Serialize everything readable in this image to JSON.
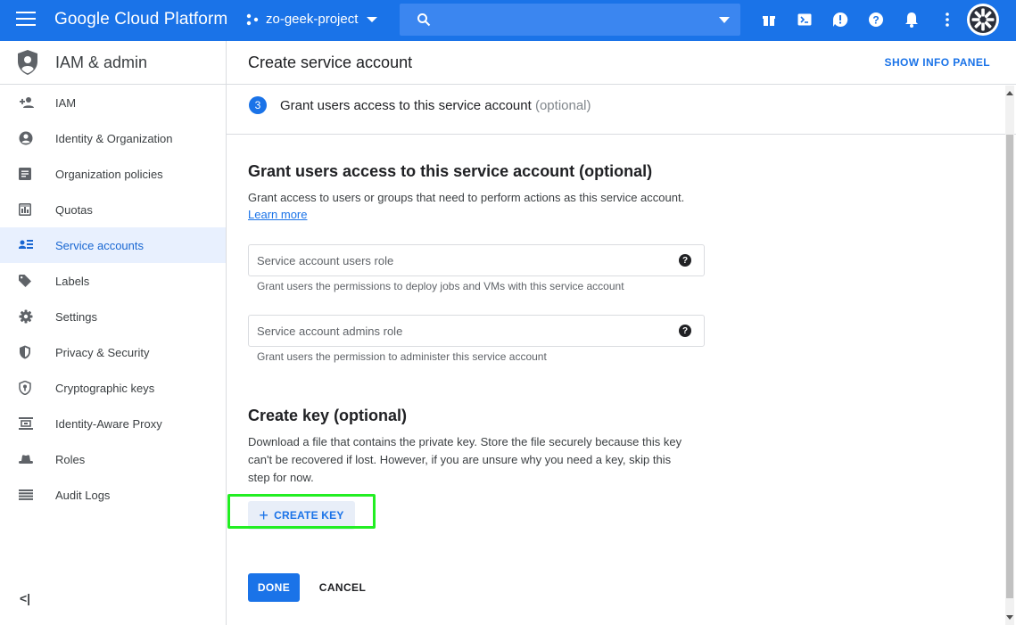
{
  "topbar": {
    "brand": "Google Cloud Platform",
    "project": "zo-geek-project",
    "search_placeholder": ""
  },
  "sidebar": {
    "title": "IAM & admin",
    "items": [
      {
        "label": "IAM",
        "icon": "person-add-icon"
      },
      {
        "label": "Identity & Organization",
        "icon": "account-circle-icon"
      },
      {
        "label": "Organization policies",
        "icon": "policy-document-icon"
      },
      {
        "label": "Quotas",
        "icon": "quota-icon"
      },
      {
        "label": "Service accounts",
        "icon": "service-account-icon",
        "active": true
      },
      {
        "label": "Labels",
        "icon": "label-tag-icon"
      },
      {
        "label": "Settings",
        "icon": "gear-icon"
      },
      {
        "label": "Privacy & Security",
        "icon": "shield-icon"
      },
      {
        "label": "Cryptographic keys",
        "icon": "key-shield-icon"
      },
      {
        "label": "Identity-Aware Proxy",
        "icon": "proxy-icon"
      },
      {
        "label": "Roles",
        "icon": "hat-icon"
      },
      {
        "label": "Audit Logs",
        "icon": "list-icon"
      }
    ],
    "collapse_label": "<|"
  },
  "main": {
    "page_title": "Create service account",
    "show_info_panel": "SHOW INFO PANEL",
    "step": {
      "number": "3",
      "label": "Grant users access to this service account",
      "optional": "(optional)"
    },
    "grant": {
      "heading": "Grant users access to this service account (optional)",
      "description": "Grant access to users or groups that need to perform actions as this service account.",
      "learn_more": "Learn more",
      "users_role_placeholder": "Service account users role",
      "users_role_hint": "Grant users the permissions to deploy jobs and VMs with this service account",
      "admins_role_placeholder": "Service account admins role",
      "admins_role_hint": "Grant users the permission to administer this service account",
      "help_glyph": "?"
    },
    "key": {
      "heading": "Create key (optional)",
      "description": "Download a file that contains the private key. Store the file securely because this key can't be recovered if lost. However, if you are unsure why you need a key, skip this step for now.",
      "create_key_label": "CREATE KEY",
      "plus_glyph": "+"
    },
    "actions": {
      "done_label": "DONE",
      "cancel_label": "CANCEL"
    }
  },
  "colors": {
    "brand_blue": "#1a73e8",
    "highlight": "#22ee22"
  }
}
